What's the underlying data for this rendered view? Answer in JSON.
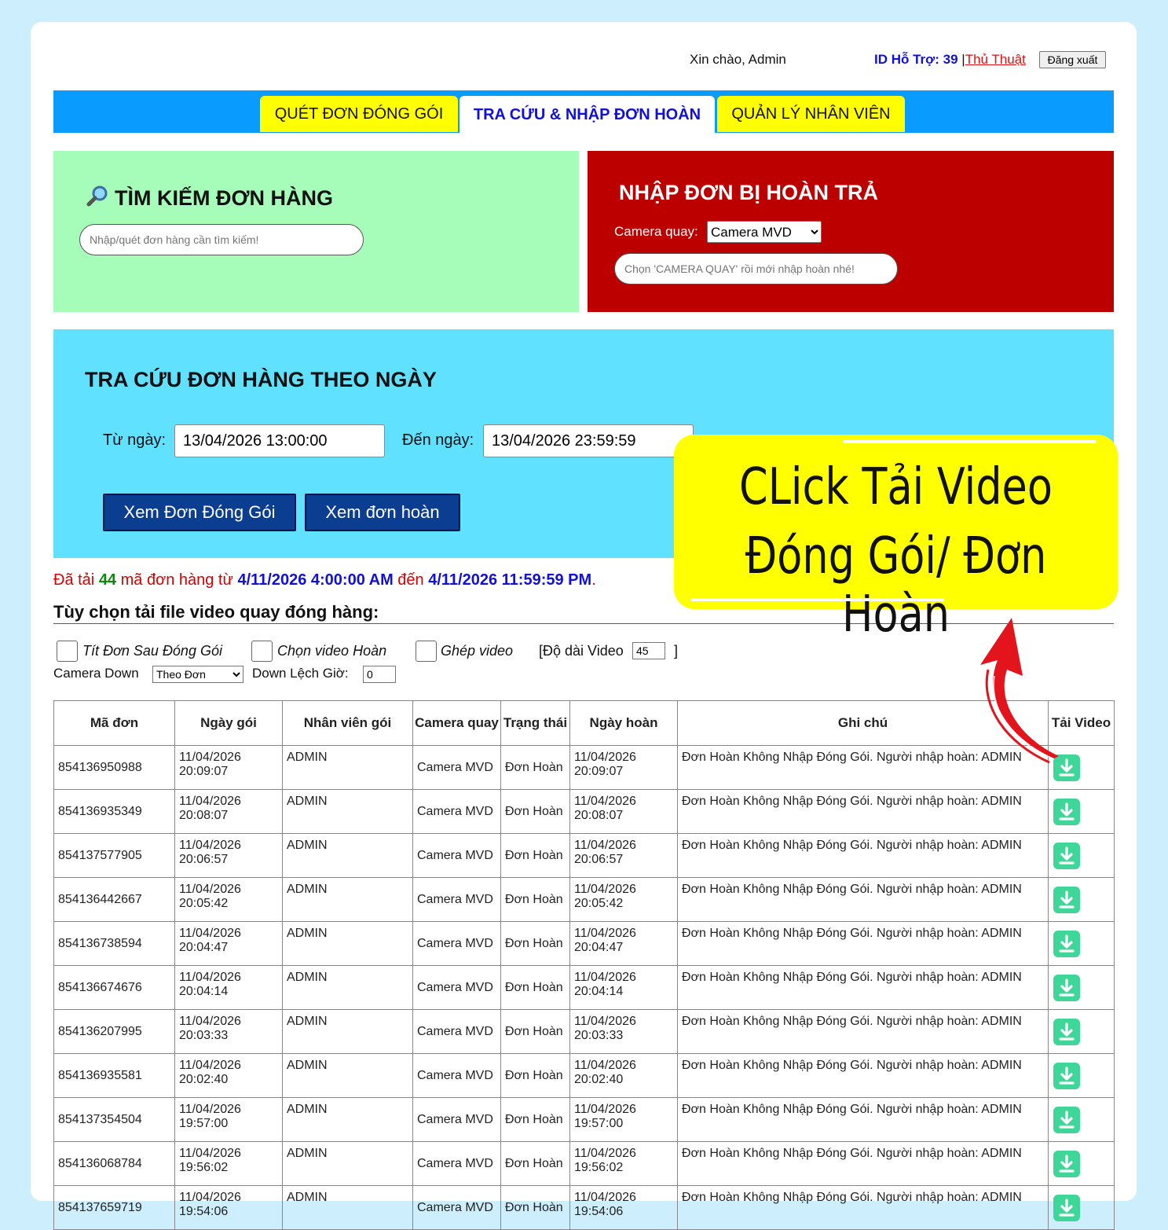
{
  "header": {
    "greeting": "Xin chào, Admin",
    "support_id": "ID Hỗ Trợ: 39",
    "separator": "|",
    "tips_link": "Thủ Thuật",
    "logout_label": "Đăng xuất"
  },
  "tabs": [
    {
      "label": "QUÉT ĐƠN ĐÓNG GÓI",
      "active": false
    },
    {
      "label": "TRA CỨU & NHẬP ĐƠN HOÀN",
      "active": true
    },
    {
      "label": "QUẢN LÝ NHÂN VIÊN",
      "active": false
    }
  ],
  "search_panel": {
    "title": "TÌM KIẾM ĐƠN HÀNG",
    "icon": "magnifier-icon",
    "placeholder": "Nhập/quét đơn hàng cần tìm kiếm!"
  },
  "return_panel": {
    "title": "NHẬP ĐƠN BỊ HOÀN TRẢ",
    "camera_label": "Camera quay:",
    "camera_selected": "Camera MVD",
    "placeholder": "Chọn 'CAMERA QUAY' rồi mới nhập hoàn nhé!"
  },
  "date_panel": {
    "title": "TRA CỨU ĐƠN HÀNG THEO NGÀY",
    "from_label": "Từ ngày:",
    "from_value": "13/04/2026 13:00:00",
    "to_label": "Đến ngày:",
    "to_value": "13/04/2026 23:59:59",
    "btn_packed": "Xem Đơn Đóng Gói",
    "btn_returned": "Xem đơn hoàn"
  },
  "status": {
    "prefix": "Đã tải",
    "count": "44",
    "middle": "mã đơn hàng từ",
    "from": "4/11/2026 4:00:00 AM",
    "to_word": "đến",
    "to": "4/11/2026 11:59:59 PM",
    "suffix": "."
  },
  "options": {
    "title": "Tùy chọn tải file video quay đóng hàng:",
    "chk1": "Tít Đơn Sau Đóng Gói",
    "chk2": "Chọn video Hoàn",
    "chk3": "Ghép video",
    "length_label": "[Độ dài Video",
    "length_value": "45",
    "length_close": "]",
    "camera_down_label": "Camera Down",
    "camera_down_selected": "Theo Đơn",
    "offset_label": "Down Lệch Giờ:",
    "offset_value": "0"
  },
  "table": {
    "headers": [
      "Mã đơn",
      "Ngày gói",
      "Nhân viên gói",
      "Camera quay",
      "Trạng thái",
      "Ngày hoàn",
      "Ghi chú",
      "Tải Video"
    ],
    "rows": [
      {
        "id": "854136950988",
        "pack_date": "11/04/2026",
        "pack_time": "20:09:07",
        "staff": "ADMIN",
        "camera": "Camera MVD",
        "status": "Đơn Hoàn",
        "ret_date": "11/04/2026",
        "ret_time": "20:09:07",
        "note": "Đơn Hoàn Không Nhập Đóng Gói. Người nhập hoàn: ADMIN"
      },
      {
        "id": "854136935349",
        "pack_date": "11/04/2026",
        "pack_time": "20:08:07",
        "staff": "ADMIN",
        "camera": "Camera MVD",
        "status": "Đơn Hoàn",
        "ret_date": "11/04/2026",
        "ret_time": "20:08:07",
        "note": "Đơn Hoàn Không Nhập Đóng Gói. Người nhập hoàn: ADMIN"
      },
      {
        "id": "854137577905",
        "pack_date": "11/04/2026",
        "pack_time": "20:06:57",
        "staff": "ADMIN",
        "camera": "Camera MVD",
        "status": "Đơn Hoàn",
        "ret_date": "11/04/2026",
        "ret_time": "20:06:57",
        "note": "Đơn Hoàn Không Nhập Đóng Gói. Người nhập hoàn: ADMIN"
      },
      {
        "id": "854136442667",
        "pack_date": "11/04/2026",
        "pack_time": "20:05:42",
        "staff": "ADMIN",
        "camera": "Camera MVD",
        "status": "Đơn Hoàn",
        "ret_date": "11/04/2026",
        "ret_time": "20:05:42",
        "note": "Đơn Hoàn Không Nhập Đóng Gói. Người nhập hoàn: ADMIN"
      },
      {
        "id": "854136738594",
        "pack_date": "11/04/2026",
        "pack_time": "20:04:47",
        "staff": "ADMIN",
        "camera": "Camera MVD",
        "status": "Đơn Hoàn",
        "ret_date": "11/04/2026",
        "ret_time": "20:04:47",
        "note": "Đơn Hoàn Không Nhập Đóng Gói. Người nhập hoàn: ADMIN"
      },
      {
        "id": "854136674676",
        "pack_date": "11/04/2026",
        "pack_time": "20:04:14",
        "staff": "ADMIN",
        "camera": "Camera MVD",
        "status": "Đơn Hoàn",
        "ret_date": "11/04/2026",
        "ret_time": "20:04:14",
        "note": "Đơn Hoàn Không Nhập Đóng Gói. Người nhập hoàn: ADMIN"
      },
      {
        "id": "854136207995",
        "pack_date": "11/04/2026",
        "pack_time": "20:03:33",
        "staff": "ADMIN",
        "camera": "Camera MVD",
        "status": "Đơn Hoàn",
        "ret_date": "11/04/2026",
        "ret_time": "20:03:33",
        "note": "Đơn Hoàn Không Nhập Đóng Gói. Người nhập hoàn: ADMIN"
      },
      {
        "id": "854136935581",
        "pack_date": "11/04/2026",
        "pack_time": "20:02:40",
        "staff": "ADMIN",
        "camera": "Camera MVD",
        "status": "Đơn Hoàn",
        "ret_date": "11/04/2026",
        "ret_time": "20:02:40",
        "note": "Đơn Hoàn Không Nhập Đóng Gói. Người nhập hoàn: ADMIN"
      },
      {
        "id": "854137354504",
        "pack_date": "11/04/2026",
        "pack_time": "19:57:00",
        "staff": "ADMIN",
        "camera": "Camera MVD",
        "status": "Đơn Hoàn",
        "ret_date": "11/04/2026",
        "ret_time": "19:57:00",
        "note": "Đơn Hoàn Không Nhập Đóng Gói. Người nhập hoàn: ADMIN"
      },
      {
        "id": "854136068784",
        "pack_date": "11/04/2026",
        "pack_time": "19:56:02",
        "staff": "ADMIN",
        "camera": "Camera MVD",
        "status": "Đơn Hoàn",
        "ret_date": "11/04/2026",
        "ret_time": "19:56:02",
        "note": "Đơn Hoàn Không Nhập Đóng Gói. Người nhập hoàn: ADMIN"
      },
      {
        "id": "854137659719",
        "pack_date": "11/04/2026",
        "pack_time": "19:54:06",
        "staff": "ADMIN",
        "camera": "Camera MVD",
        "status": "Đơn Hoàn",
        "ret_date": "11/04/2026",
        "ret_time": "19:54:06",
        "note": "Đơn Hoàn Không Nhập Đóng Gói. Người nhập hoàn: ADMIN"
      }
    ]
  },
  "callout": {
    "line1": "CLick Tải Video",
    "line2": "Đóng Gói/ Đơn Hoàn"
  },
  "colors": {
    "tabbar": "#0a9bff",
    "tab_yellow": "#ffff00",
    "green_panel": "#a6fcb9",
    "red_panel": "#bc0000",
    "blue_panel": "#60e1ff",
    "button_dark": "#0b3d91",
    "download_green": "#3fd69a",
    "arrow_red": "#e3141c"
  }
}
